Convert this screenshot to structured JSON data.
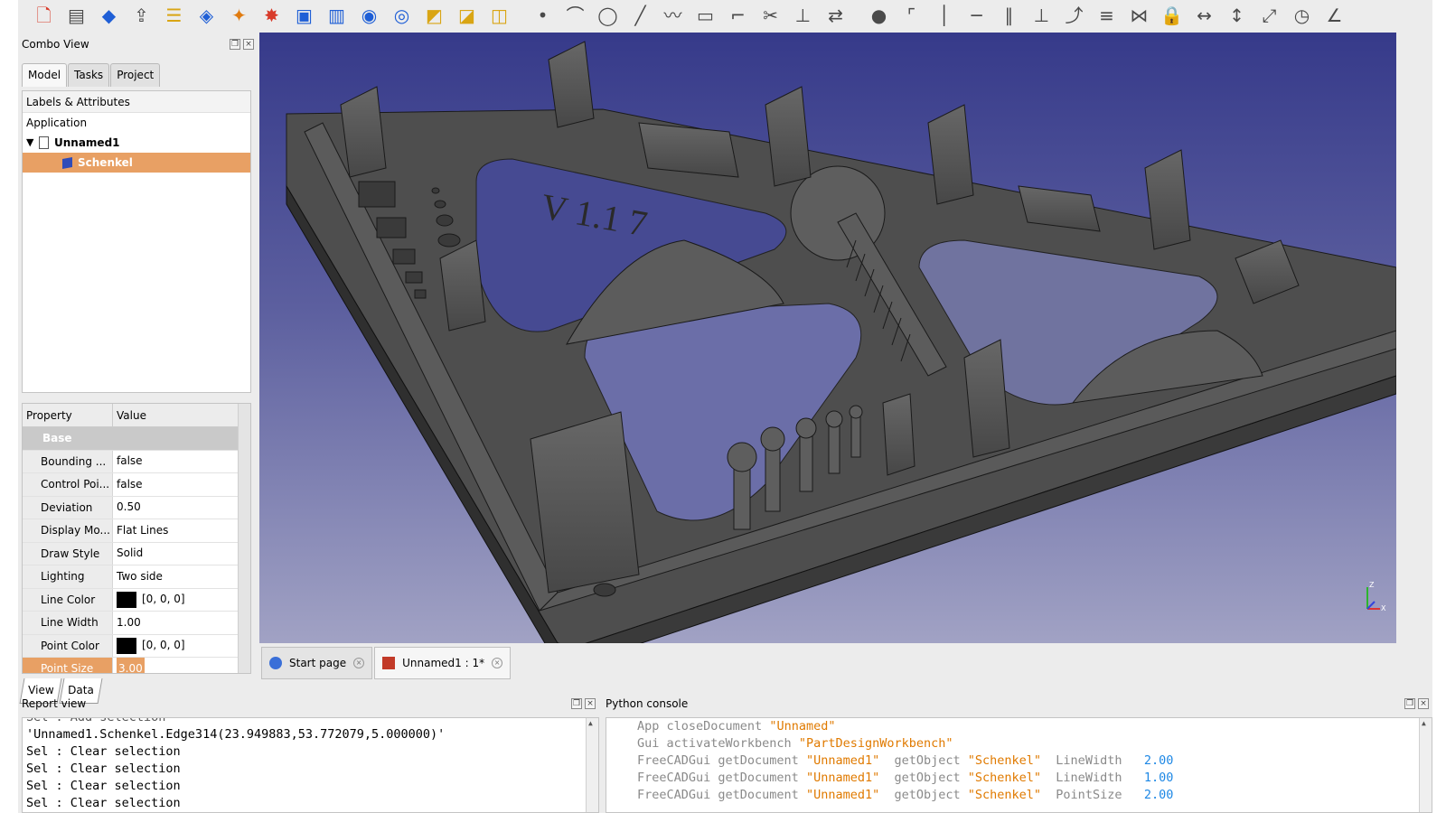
{
  "toolbar": {
    "icons": [
      "new-document-icon",
      "open-document-icon",
      "part-cube-icon",
      "export-icon",
      "layers-icon",
      "workbench-blue-icon",
      "workbench-orange-icon",
      "star-tool-icon",
      "pad-icon",
      "pocket-icon",
      "revolution-icon",
      "groove-icon",
      "fillet-icon",
      "chamfer-icon",
      "draft-icon",
      "point-icon",
      "arc-icon",
      "circle-icon",
      "line-icon",
      "polyline-icon",
      "rectangle-icon",
      "trim-icon",
      "cut-icon",
      "drill-icon",
      "mirror-icon",
      "dot-icon",
      "fillet-sketch-icon",
      "vertical-icon",
      "horizontal-icon",
      "parallel-icon",
      "perpendicular-icon",
      "tangent-icon",
      "equal-icon",
      "symmetric-icon",
      "lock-icon",
      "horizontal-distance-icon",
      "vertical-distance-icon",
      "length-icon",
      "radius-icon",
      "angle-icon"
    ]
  },
  "combo_view": {
    "title": "Combo View",
    "tabs": [
      "Model",
      "Tasks",
      "Project"
    ],
    "tree_header": "Labels & Attributes",
    "tree": {
      "application": "Application",
      "document": "Unnamed1",
      "object": "Schenkel"
    },
    "props_header": {
      "property": "Property",
      "value": "Value"
    },
    "group": "Base",
    "properties": [
      {
        "k": "Bounding ...",
        "v": "false"
      },
      {
        "k": "Control Poi...",
        "v": "false"
      },
      {
        "k": "Deviation",
        "v": "0.50"
      },
      {
        "k": "Display Mo...",
        "v": "Flat Lines"
      },
      {
        "k": "Draw Style",
        "v": "Solid"
      },
      {
        "k": "Lighting",
        "v": "Two side"
      },
      {
        "k": "Line Color",
        "v": "[0, 0, 0]"
      },
      {
        "k": "Line Width",
        "v": "1.00"
      },
      {
        "k": "Point Color",
        "v": "[0, 0, 0]"
      },
      {
        "k": "Point Size",
        "v": "3.00"
      }
    ],
    "bottom_tabs": [
      "View",
      "Data"
    ]
  },
  "mdi_tabs": {
    "start": "Start page",
    "doc": "Unnamed1 : 1*"
  },
  "report": {
    "title": "Report view",
    "lines": [
      "Sel : Add selection",
      "'Unnamed1.Schenkel.Edge314(23.949883,53.772079,5.000000)'",
      "Sel : Clear selection",
      "Sel : Clear selection",
      "Sel : Clear selection",
      "Sel : Clear selection"
    ]
  },
  "python": {
    "title": "Python console",
    "lines": [
      {
        "a": "App closeDocument ",
        "s": "\"Unnamed\"",
        "b": "",
        "n": ""
      },
      {
        "a": "Gui activateWorkbench ",
        "s": "\"PartDesignWorkbench\"",
        "b": "",
        "n": ""
      },
      {
        "a": "FreeCADGui getDocument ",
        "s": "\"Unnamed1\"",
        "b": "  getObject ",
        "s2": "\"Schenkel\"",
        "c": "  LineWidth   ",
        "n": "2.00"
      },
      {
        "a": "FreeCADGui getDocument ",
        "s": "\"Unnamed1\"",
        "b": "  getObject ",
        "s2": "\"Schenkel\"",
        "c": "  LineWidth   ",
        "n": "1.00"
      },
      {
        "a": "FreeCADGui getDocument ",
        "s": "\"Unnamed1\"",
        "b": "  getObject ",
        "s2": "\"Schenkel\"",
        "c": "  PointSize   ",
        "n": "2.00"
      }
    ]
  },
  "viewport": {
    "engraving": "V 1.1 7",
    "axis": {
      "z": "Z",
      "x": "X"
    }
  },
  "colors": {
    "selection": "#e8a064",
    "bg_top": "#363a8a",
    "bg_bottom": "#a1a2c4",
    "model": "#555555",
    "string": "#e07a00",
    "number": "#1e88e5"
  }
}
